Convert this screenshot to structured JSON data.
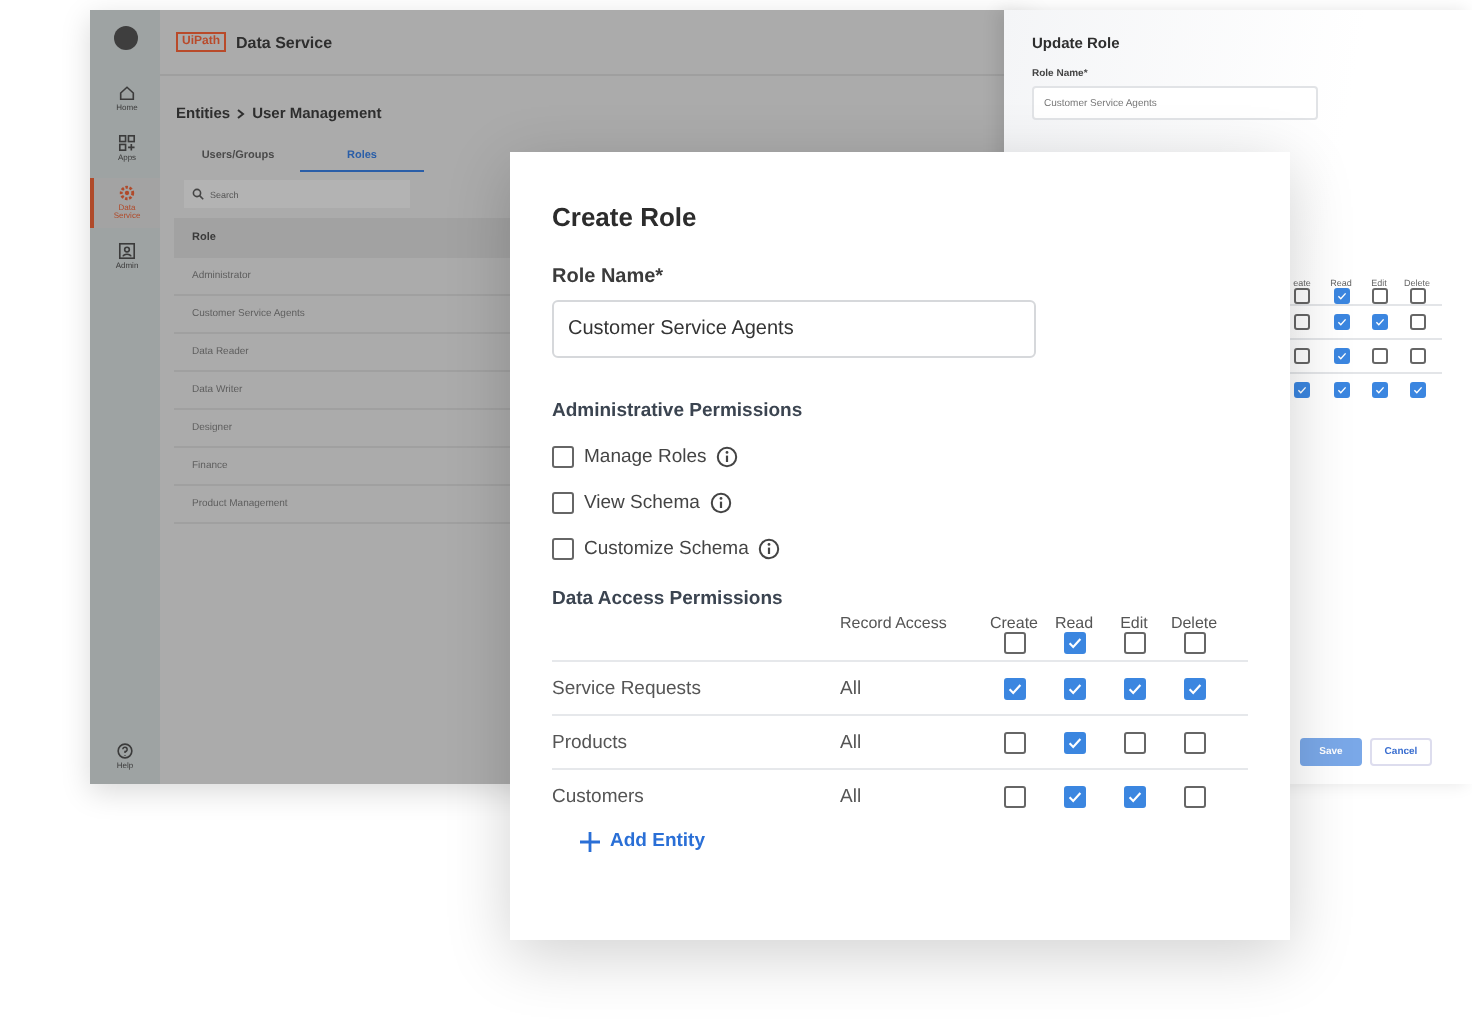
{
  "app": {
    "logo": "UiPath",
    "title": "Data Service",
    "nav": [
      {
        "label": "Home",
        "kind": "home",
        "selected": false
      },
      {
        "label": "Apps",
        "kind": "apps",
        "selected": false
      },
      {
        "label": "Data Service",
        "kind": "data",
        "selected": true
      },
      {
        "label": "Admin",
        "kind": "admin",
        "selected": false
      }
    ],
    "help": "Help",
    "breadcrumb": [
      "Entities",
      "User Management"
    ],
    "tabs": [
      {
        "label": "Users/Groups",
        "selected": false
      },
      {
        "label": "Roles",
        "selected": true
      }
    ],
    "search": {
      "placeholder": "Search"
    },
    "table": {
      "columns": [
        "Role"
      ],
      "rows": [
        "Administrator",
        "Customer Service Agents",
        "Data Reader",
        "Data Writer",
        "Designer",
        "Finance",
        "Product Management"
      ]
    }
  },
  "update_role": {
    "title": "Update Role",
    "role_name_label": "Role Name*",
    "role_name_value": "Customer Service Agents",
    "columns": [
      "eate",
      "Read",
      "Edit",
      "Delete"
    ],
    "header_checks": [
      false,
      true,
      false,
      false
    ],
    "rows": [
      {
        "checks": [
          false,
          true,
          true,
          false
        ]
      },
      {
        "checks": [
          false,
          true,
          false,
          false
        ]
      },
      {
        "checks": [
          true,
          true,
          true,
          true
        ]
      }
    ],
    "buttons": [
      {
        "label": "Save",
        "kind": "primary"
      },
      {
        "label": "Cancel",
        "kind": "secondary"
      }
    ]
  },
  "create_role": {
    "title": "Create Role",
    "role_name_label": "Role Name*",
    "role_name_value": "Customer Service Agents",
    "admin_title": "Administrative Permissions",
    "admin_permissions": [
      {
        "label": "Manage Roles",
        "checked": false
      },
      {
        "label": "View Schema",
        "checked": false
      },
      {
        "label": "Customize Schema",
        "checked": false
      }
    ],
    "data_title": "Data Access Permissions",
    "columns": [
      "Record Access",
      "Create",
      "Read",
      "Edit",
      "Delete"
    ],
    "header_checks": [
      false,
      true,
      false,
      false
    ],
    "rows": [
      {
        "entity": "Service Requests",
        "record_access": "All",
        "checks": [
          true,
          true,
          true,
          true
        ]
      },
      {
        "entity": "Products",
        "record_access": "All",
        "checks": [
          false,
          true,
          false,
          false
        ]
      },
      {
        "entity": "Customers",
        "record_access": "All",
        "checks": [
          false,
          true,
          true,
          false
        ]
      }
    ],
    "add_entity": "Add Entity"
  }
}
